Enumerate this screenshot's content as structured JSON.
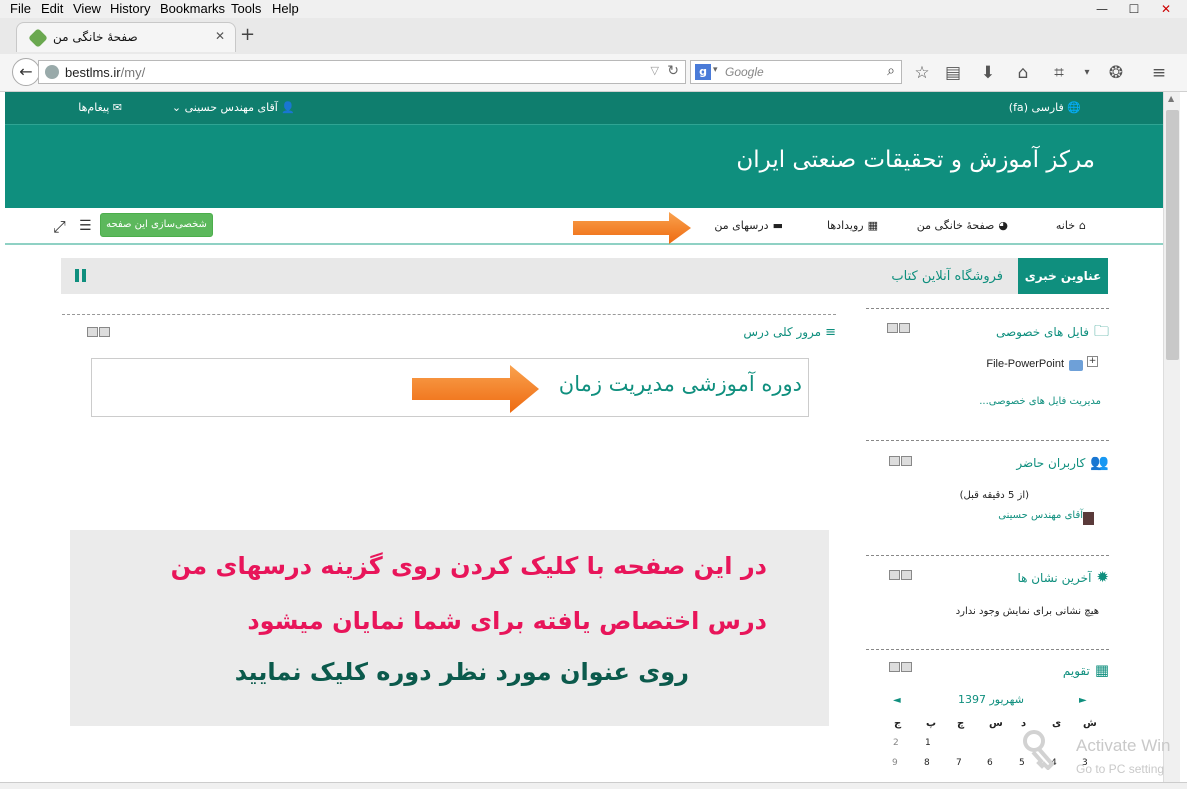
{
  "browser": {
    "menu": [
      "File",
      "Edit",
      "View",
      "History",
      "Bookmarks",
      "Tools",
      "Help"
    ],
    "tab_title": "صفحهٔ خانگی من",
    "url_host": "bestlms.ir",
    "url_path": "/my/",
    "search_placeholder": "Google"
  },
  "topbar": {
    "language": "فارسی (fa)",
    "user": "آقای مهندس حسینی",
    "messages": "پیغام‌ها"
  },
  "header": {
    "site_name": "مرکز آموزش و تحقیقات صنعتی ایران"
  },
  "nav": {
    "home": "خانه",
    "dashboard": "صفحهٔ خانگی من",
    "events": "رویدادها",
    "my_courses": "درسهای من",
    "customize": "شخصی‌سازی این صفحه"
  },
  "tabs": {
    "news": "عناوین خبری",
    "shop": "فروشگاه آنلاین کتاب"
  },
  "main": {
    "overview_title": "مرور کلی درس",
    "course_name": "دوره آموزشی مدیریت زمان"
  },
  "instructions": {
    "line1": "در این صفحه با کلیک کردن روی گزینه درسهای من",
    "line2": "درس اختصاص یافته برای شما نمایان میشود",
    "line3": "روی عنوان مورد نظر دوره کلیک نمایید",
    "colors": {
      "red": "#e8155a",
      "green": "#0b5a4c"
    }
  },
  "blocks": {
    "private_files": {
      "title": "فایل های خصوصی",
      "file": "File-PowerPoint",
      "manage_link": "مدیریت فایل های خصوصی..."
    },
    "online_users": {
      "title": "کاربران حاضر",
      "period": "(از 5 دقیقه قبل)",
      "user": "آقای مهندس حسینی"
    },
    "latest_badges": {
      "title": "آخرین نشان ها",
      "empty": "هیچ نشانی برای نمایش وجود ندارد"
    },
    "calendar": {
      "title": "تقویم",
      "month": "شهریور 1397",
      "weekdays": [
        "ش",
        "ی",
        "د",
        "س",
        "چ",
        "پ",
        "ج"
      ],
      "row1": [
        "1",
        "2"
      ],
      "row2": [
        "3",
        "4",
        "5",
        "6",
        "7",
        "8",
        "9"
      ]
    }
  },
  "watermark": {
    "line1": "Activate Win",
    "line2": "Go to PC setting"
  },
  "colors": {
    "teal": "#0f8f7e",
    "teal_dark": "#0f7e6e",
    "orange": "#f47b20",
    "green_button": "#5cb85c"
  }
}
